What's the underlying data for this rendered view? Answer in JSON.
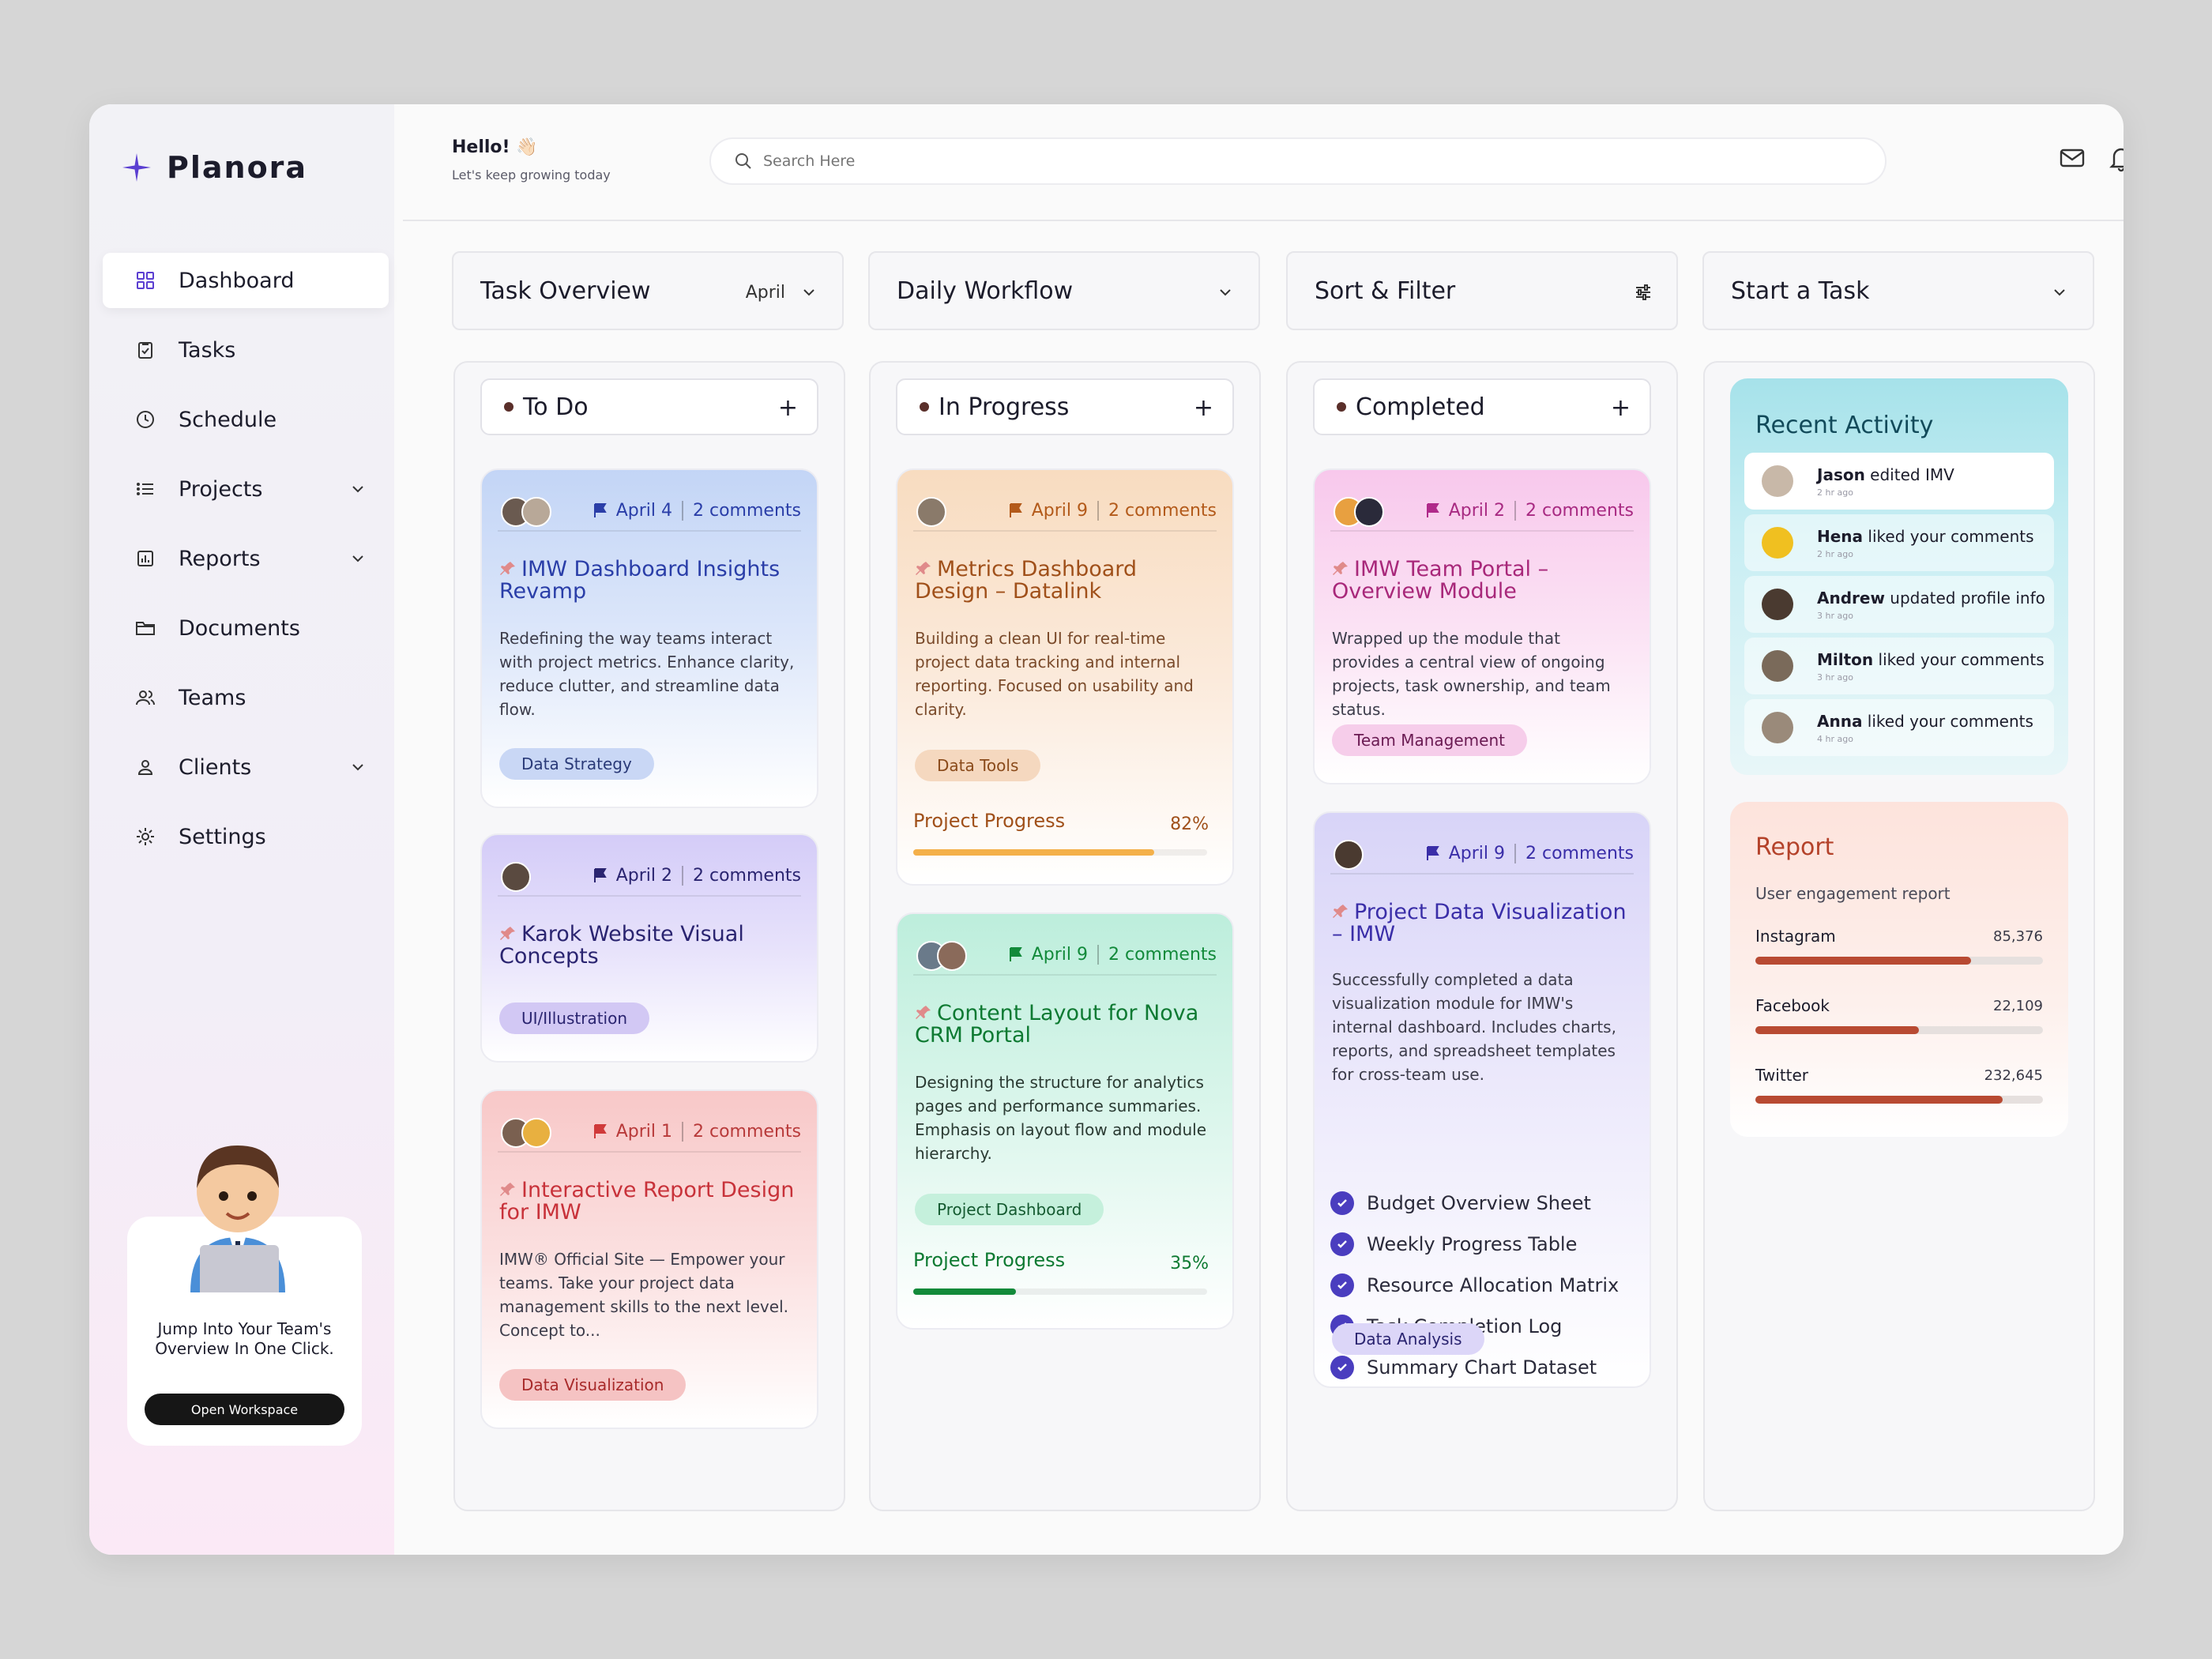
{
  "app": {
    "name": "Planora"
  },
  "colors": {
    "accent": "#5b3fd1",
    "sidebar_active_bg": "#ffffff",
    "report_bar": "#b84a32"
  },
  "sidebar": {
    "items": [
      {
        "label": "Dashboard",
        "icon": "grid-icon",
        "active": true
      },
      {
        "label": "Tasks",
        "icon": "clipboard-check-icon"
      },
      {
        "label": "Schedule",
        "icon": "clock-icon"
      },
      {
        "label": "Projects",
        "icon": "list-icon",
        "chevron": true
      },
      {
        "label": "Reports",
        "icon": "bar-chart-icon",
        "chevron": true
      },
      {
        "label": "Documents",
        "icon": "folder-icon"
      },
      {
        "label": "Teams",
        "icon": "users-icon"
      },
      {
        "label": "Clients",
        "icon": "user-icon",
        "chevron": true
      },
      {
        "label": "Settings",
        "icon": "gear-icon"
      }
    ],
    "promo": {
      "text": "Jump Into Your Team's Overview In One Click.",
      "button": "Open Workspace"
    }
  },
  "header": {
    "greeting": "Hello! 👋🏻",
    "sub": "Let's keep growing today",
    "search_placeholder": "Search Here"
  },
  "columns": {
    "overview": {
      "title": "Task Overview",
      "extra": "April"
    },
    "workflow": {
      "title": "Daily Workflow"
    },
    "filter": {
      "title": "Sort & Filter"
    },
    "start": {
      "title": "Start a Task"
    }
  },
  "todo": {
    "label": "To Do",
    "cards": [
      {
        "date": "April 4",
        "comments": "2 comments",
        "title": "IMW Dashboard Insights Revamp",
        "desc": "Redefining the way teams interact with project metrics. Enhance clarity, reduce clutter, and streamline data flow.",
        "tag": "Data Strategy"
      },
      {
        "date": "April 2",
        "comments": "2 comments",
        "title": "Karok Website Visual Concepts",
        "tag": "UI/Illustration"
      },
      {
        "date": "April 1",
        "comments": "2 comments",
        "title": "Interactive Report Design for IMW",
        "desc": "IMW® Official Site — Empower your teams. Take your project data management skills to the next level. Concept to...",
        "tag": "Data Visualization"
      }
    ]
  },
  "inprogress": {
    "label": "In Progress",
    "cards": [
      {
        "date": "April 9",
        "comments": "2 comments",
        "title": "Metrics Dashboard Design – Datalink",
        "desc": "Building a clean UI for real-time project data tracking and internal reporting. Focused on usability and clarity.",
        "tag": "Data Tools",
        "progress_label": "Project Progress",
        "progress": 82,
        "progress_text": "82%"
      },
      {
        "date": "April 9",
        "comments": "2 comments",
        "title": "Content Layout for Nova CRM Portal",
        "desc": "Designing the structure for analytics pages and performance summaries. Emphasis on layout flow and module hierarchy.",
        "tag": "Project Dashboard",
        "progress_label": "Project Progress",
        "progress": 35,
        "progress_text": "35%"
      }
    ]
  },
  "completed": {
    "label": "Completed",
    "cards": [
      {
        "date": "April 2",
        "comments": "2 comments",
        "title": "IMW Team Portal – Overview Module",
        "desc": "Wrapped up the module that provides a central view of ongoing projects, task ownership, and team status.",
        "tag": "Team Management"
      },
      {
        "date": "April 9",
        "comments": "2 comments",
        "title": "Project Data Visualization – IMW",
        "desc": "Successfully completed a data visualization module for IMW's internal dashboard. Includes charts, reports, and spreadsheet templates for cross-team use.",
        "checklist": [
          "Budget Overview Sheet",
          "Weekly Progress Table",
          "Resource Allocation Matrix",
          "Task Completion Log",
          "Summary Chart Dataset"
        ],
        "tag": "Data Analysis"
      }
    ]
  },
  "recent": {
    "title": "Recent Activity",
    "items": [
      {
        "name": "Jason",
        "action": " edited IMV",
        "time": "2 hr ago"
      },
      {
        "name": "Hena",
        "action": " liked your comments",
        "time": "2 hr ago"
      },
      {
        "name": "Andrew",
        "action": " updated profile info",
        "time": "3 hr ago"
      },
      {
        "name": "Milton",
        "action": " liked your comments",
        "time": "3 hr ago"
      },
      {
        "name": "Anna",
        "action": " liked your comments",
        "time": "4 hr ago"
      }
    ]
  },
  "report": {
    "title": "Report",
    "sub": "User engagement report",
    "rows": [
      {
        "label": "Instagram",
        "value": "85,376",
        "fraction": 0.75
      },
      {
        "label": "Facebook",
        "value": "22,109",
        "fraction": 0.57
      },
      {
        "label": "Twitter",
        "value": "232,645",
        "fraction": 0.86
      }
    ]
  }
}
